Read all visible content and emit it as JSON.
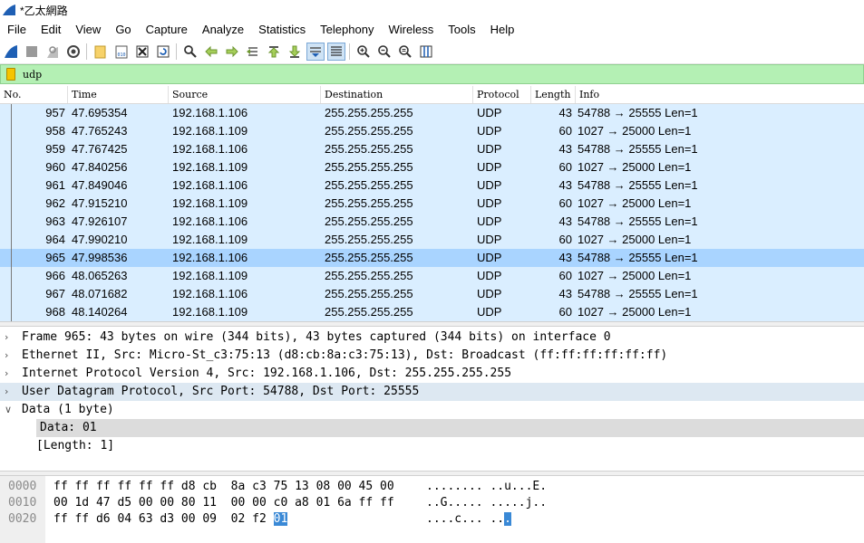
{
  "window": {
    "title": "*乙太網路"
  },
  "menu": [
    "File",
    "Edit",
    "View",
    "Go",
    "Capture",
    "Analyze",
    "Statistics",
    "Telephony",
    "Wireless",
    "Tools",
    "Help"
  ],
  "toolbar_icons": [
    "shark-fin-start-icon",
    "stop-square-icon",
    "restart-fin-icon",
    "capture-options-gear-icon",
    "open-folder-icon",
    "save-file-icon",
    "close-file-icon",
    "reload-icon",
    "find-magnifier-icon",
    "go-back-arrow-icon",
    "go-forward-arrow-icon",
    "go-to-packet-icon",
    "go-first-icon",
    "go-last-icon",
    "autoscroll-icon",
    "colorize-icon",
    "zoom-in-icon",
    "zoom-out-icon",
    "normal-size-icon",
    "resize-columns-icon"
  ],
  "filter": {
    "value": "udp"
  },
  "columns": [
    "No.",
    "Time",
    "Source",
    "Destination",
    "Protocol",
    "Length",
    "Info"
  ],
  "packets": [
    {
      "no": "957",
      "time": "47.695354",
      "src": "192.168.1.106",
      "dst": "255.255.255.255",
      "proto": "UDP",
      "len": "43",
      "info": "54788 → 25555 Len=1"
    },
    {
      "no": "958",
      "time": "47.765243",
      "src": "192.168.1.109",
      "dst": "255.255.255.255",
      "proto": "UDP",
      "len": "60",
      "info": "1027 → 25000 Len=1"
    },
    {
      "no": "959",
      "time": "47.767425",
      "src": "192.168.1.106",
      "dst": "255.255.255.255",
      "proto": "UDP",
      "len": "43",
      "info": "54788 → 25555 Len=1"
    },
    {
      "no": "960",
      "time": "47.840256",
      "src": "192.168.1.109",
      "dst": "255.255.255.255",
      "proto": "UDP",
      "len": "60",
      "info": "1027 → 25000 Len=1"
    },
    {
      "no": "961",
      "time": "47.849046",
      "src": "192.168.1.106",
      "dst": "255.255.255.255",
      "proto": "UDP",
      "len": "43",
      "info": "54788 → 25555 Len=1"
    },
    {
      "no": "962",
      "time": "47.915210",
      "src": "192.168.1.109",
      "dst": "255.255.255.255",
      "proto": "UDP",
      "len": "60",
      "info": "1027 → 25000 Len=1"
    },
    {
      "no": "963",
      "time": "47.926107",
      "src": "192.168.1.106",
      "dst": "255.255.255.255",
      "proto": "UDP",
      "len": "43",
      "info": "54788 → 25555 Len=1"
    },
    {
      "no": "964",
      "time": "47.990210",
      "src": "192.168.1.109",
      "dst": "255.255.255.255",
      "proto": "UDP",
      "len": "60",
      "info": "1027 → 25000 Len=1"
    },
    {
      "no": "965",
      "time": "47.998536",
      "src": "192.168.1.106",
      "dst": "255.255.255.255",
      "proto": "UDP",
      "len": "43",
      "info": "54788 → 25555 Len=1",
      "selected": true
    },
    {
      "no": "966",
      "time": "48.065263",
      "src": "192.168.1.109",
      "dst": "255.255.255.255",
      "proto": "UDP",
      "len": "60",
      "info": "1027 → 25000 Len=1"
    },
    {
      "no": "967",
      "time": "48.071682",
      "src": "192.168.1.106",
      "dst": "255.255.255.255",
      "proto": "UDP",
      "len": "43",
      "info": "54788 → 25555 Len=1"
    },
    {
      "no": "968",
      "time": "48.140264",
      "src": "192.168.1.109",
      "dst": "255.255.255.255",
      "proto": "UDP",
      "len": "60",
      "info": "1027 → 25000 Len=1"
    }
  ],
  "details": [
    {
      "arrow": "›",
      "text": "Frame 965: 43 bytes on wire (344 bits), 43 bytes captured (344 bits) on interface 0",
      "level": 0,
      "style": "none"
    },
    {
      "arrow": "›",
      "text": "Ethernet II, Src: Micro-St_c3:75:13 (d8:cb:8a:c3:75:13), Dst: Broadcast (ff:ff:ff:ff:ff:ff)",
      "level": 0,
      "style": "none"
    },
    {
      "arrow": "›",
      "text": "Internet Protocol Version 4, Src: 192.168.1.106, Dst: 255.255.255.255",
      "level": 0,
      "style": "none"
    },
    {
      "arrow": "›",
      "text": "User Datagram Protocol, Src Port: 54788, Dst Port: 25555",
      "level": 0,
      "style": "light"
    },
    {
      "arrow": "∨",
      "text": "Data (1 byte)",
      "level": 0,
      "style": "none"
    },
    {
      "arrow": "",
      "text": "Data: 01",
      "level": 1,
      "style": "gray"
    },
    {
      "arrow": "",
      "text": "[Length: 1]",
      "level": 1,
      "style": "none"
    }
  ],
  "hex": [
    {
      "offset": "0000",
      "bytes": "ff ff ff ff ff ff d8 cb  8a c3 75 13 08 00 45 00",
      "ascii": "........ ..u...E.",
      "hl_hex": "",
      "hl_ascii": ""
    },
    {
      "offset": "0010",
      "bytes": "00 1d 47 d5 00 00 80 11  00 00 c0 a8 01 6a ff ff",
      "ascii": "..G..... .....j..",
      "hl_hex": "",
      "hl_ascii": ""
    },
    {
      "offset": "0020",
      "bytes": "ff ff d6 04 63 d3 00 09  02 f2 ",
      "ascii": "....c... ..",
      "hl_hex": "01",
      "hl_ascii": "."
    }
  ],
  "colors": {
    "row_bg": "#daeeff",
    "row_selected": "#a9d4ff",
    "filter_bg": "#b4f0b4",
    "hex_highlight": "#3a89d6"
  }
}
